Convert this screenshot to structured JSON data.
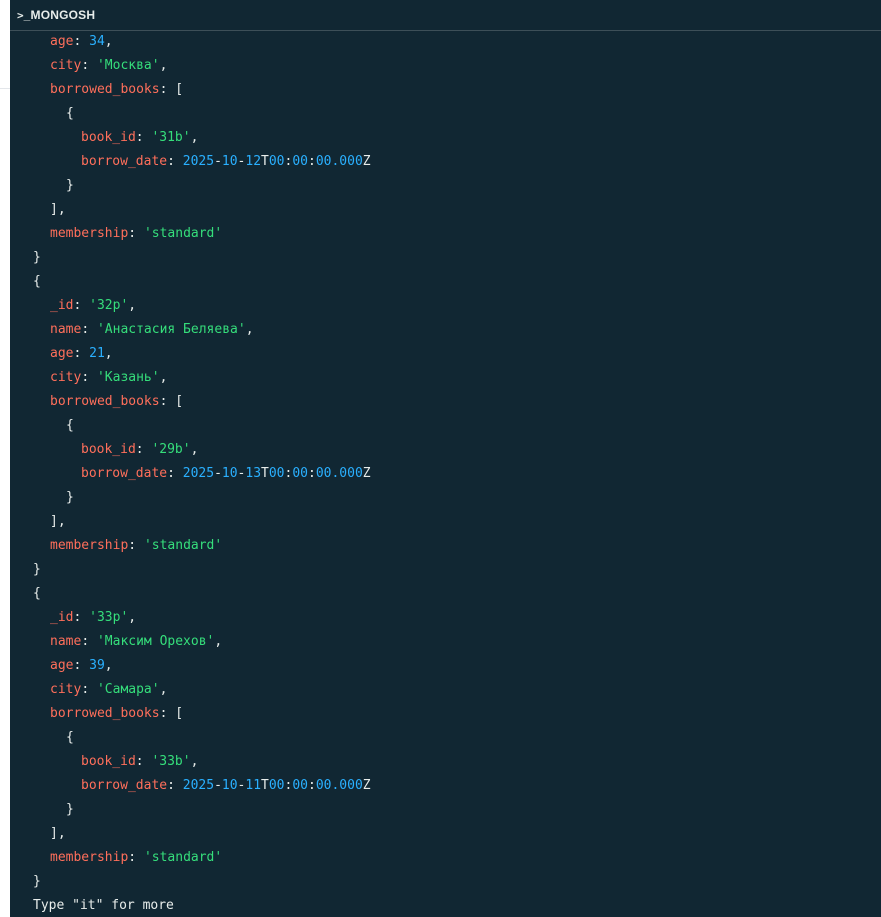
{
  "header": {
    "title": "_MONGOSH",
    "prompt_glyph": ">"
  },
  "colors": {
    "background": "#112733",
    "key": "#ff6f5b",
    "string": "#35de7b",
    "number": "#2ab0ff",
    "text": "#e8edeb"
  },
  "partial_record": {
    "age": "34",
    "city": "'Москва'",
    "borrowed": {
      "book_id": "'31b'",
      "borrow_date": {
        "y": "2025",
        "m": "10",
        "d": "12",
        "hh": "00",
        "mm": "00",
        "ss": "00.000"
      }
    },
    "membership": "'standard'"
  },
  "records": [
    {
      "_id": "'32p'",
      "name": "'Анастасия Беляева'",
      "age": "21",
      "city": "'Казань'",
      "borrowed": {
        "book_id": "'29b'",
        "borrow_date": {
          "y": "2025",
          "m": "10",
          "d": "13",
          "hh": "00",
          "mm": "00",
          "ss": "00.000"
        }
      },
      "membership": "'standard'"
    },
    {
      "_id": "'33p'",
      "name": "'Максим Орехов'",
      "age": "39",
      "city": "'Самара'",
      "borrowed": {
        "book_id": "'33b'",
        "borrow_date": {
          "y": "2025",
          "m": "10",
          "d": "11",
          "hh": "00",
          "mm": "00",
          "ss": "00.000"
        }
      },
      "membership": "'standard'"
    }
  ],
  "keys": {
    "id": "_id",
    "name": "name",
    "age": "age",
    "city": "city",
    "borrowed_books": "borrowed_books",
    "book_id": "book_id",
    "borrow_date": "borrow_date",
    "membership": "membership"
  },
  "footer_text": "Type \"it\" for more"
}
